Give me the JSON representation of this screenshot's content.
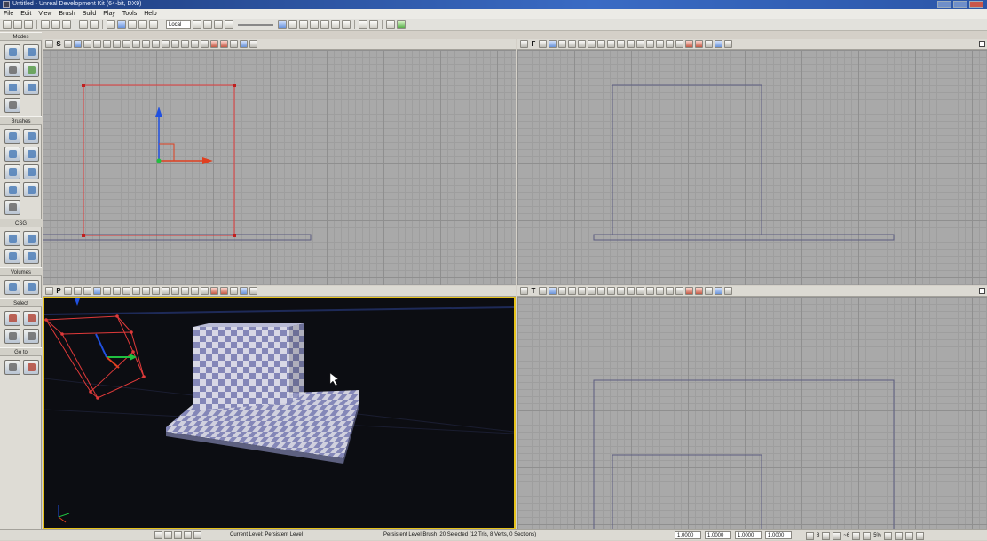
{
  "window": {
    "title": "Untitled - Unreal Development Kit (64-bit, DX9)"
  },
  "menu": [
    "File",
    "Edit",
    "View",
    "Brush",
    "Build",
    "Play",
    "Tools",
    "Help"
  ],
  "toolbar": {
    "coord_system": "Local"
  },
  "left_panel": {
    "modes_label": "Modes",
    "brushes_label": "Brushes",
    "csg_label": "CSG",
    "volumes_label": "Volumes",
    "select_label": "Select",
    "goto_label": "Go to"
  },
  "viewports": {
    "top_left": {
      "label": "S"
    },
    "top_right": {
      "label": "F"
    },
    "bottom_left": {
      "label": "P"
    },
    "bottom_right": {
      "label": "T"
    }
  },
  "status": {
    "current_level": "Current Level:  Persistent Level",
    "selection": "Persistent Level.Brush_20 Selected (12 Tris, 8 Verts, 0 Sections)",
    "drag_grid": [
      "1.0000",
      "1.0000",
      "1.0000",
      "1.0000"
    ],
    "grid_size": "8",
    "rotation_snap": "~6",
    "scale_snap": "5%"
  },
  "colors": {
    "selected_brush": "#e03a3a",
    "viewport_highlight": "#e6c21c",
    "x_axis": "#e04020",
    "y_axis": "#20c040",
    "z_axis": "#2050e0"
  }
}
